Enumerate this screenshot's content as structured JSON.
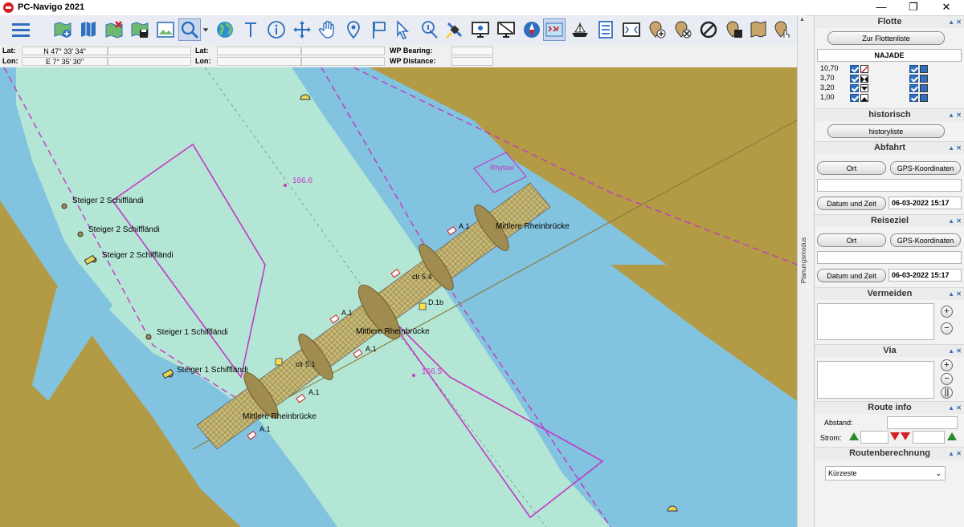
{
  "window": {
    "title": "PC-Navigo 2021"
  },
  "coords": {
    "lat_label": "Lat:",
    "lon_label": "Lon:",
    "lat_value": "N 47° 33' 34\"",
    "lon_value": "E 7° 35' 30\"",
    "lat2_label": "Lat:",
    "lon2_label": "Lon:",
    "wp_bearing_label": "WP Bearing:",
    "wp_distance_label": "WP Distance:"
  },
  "map": {
    "labels": {
      "steiger2_a": "Steiger 2 Schiffländi",
      "steiger2_b": "Steiger 2 Schiffländi",
      "steiger2_c": "Steiger 2 Schiffländi",
      "steiger1_a": "Steiger 1 Schiffländi",
      "steiger1_b": "Steiger 1 Schiffländi",
      "km_166_6": "166.6",
      "km_166_5": "166.5",
      "rhytaxi": "Rhytaxi",
      "bridge_top": "Mittlere Rheinbrücke",
      "bridge_mid": "Mittlere Rheinbrücke",
      "bridge_bottom": "Mittlere Rheinbrücke",
      "a1_1": "A.1",
      "a1_2": "A.1",
      "a1_3": "A.1",
      "a1_4": "A.1",
      "a1_5": "A.1",
      "clr54": "clr 5.4",
      "clr51": "clr 5.1",
      "d1b": "D.1b"
    }
  },
  "panel": {
    "planungsmodus": "Planungsmodus",
    "flotte": {
      "title": "Flotte",
      "flottenliste_btn": "Zur Flottenliste",
      "vessel": "NAJADE",
      "heights": [
        "10,70",
        "3,70",
        "3,20",
        "1,00"
      ]
    },
    "historisch": {
      "title": "historisch",
      "btn": "historyliste"
    },
    "abfahrt": {
      "title": "Abfahrt",
      "ort_btn": "Ort",
      "gps_btn": "GPS-Koordinaten",
      "datum_btn": "Datum und Zeit",
      "datetime": "06-03-2022 15:17"
    },
    "reiseziel": {
      "title": "Reiseziel",
      "ort_btn": "Ort",
      "gps_btn": "GPS-Koordinaten",
      "datum_btn": "Datum und Zeit",
      "datetime": "06-03-2022 15:17"
    },
    "vermeiden": {
      "title": "Vermeiden"
    },
    "via": {
      "title": "Via"
    },
    "route_info": {
      "title": "Route info",
      "abstand_label": "Abstand:",
      "strom_label": "Strom:"
    },
    "routenberechnung": {
      "title": "Routenberechnung",
      "selected": "Kürzeste"
    }
  },
  "colors": {
    "land": "#b39a44",
    "water_deep": "#82c3e0",
    "water_shallow": "#b4e6d6",
    "route": "#c338c3",
    "accent": "#2f6fbf"
  }
}
